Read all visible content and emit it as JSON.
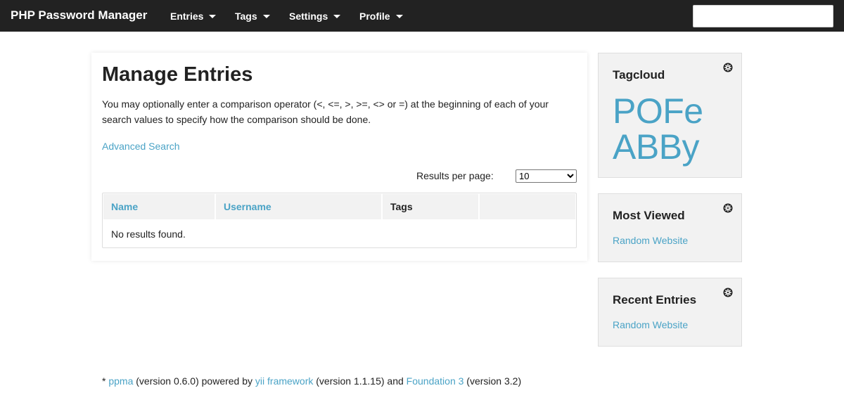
{
  "topbar": {
    "brand": "PHP Password Manager",
    "nav": [
      "Entries",
      "Tags",
      "Settings",
      "Profile"
    ],
    "search_value": ""
  },
  "main": {
    "title": "Manage Entries",
    "description": "You may optionally enter a comparison operator (<, <=, >, >=, <> or =) at the beginning of each of your search values to specify how the comparison should be done.",
    "advanced_search": "Advanced Search",
    "results_per_page_label": "Results per page:",
    "results_per_page_value": "10",
    "table": {
      "columns": [
        "Name",
        "Username",
        "Tags",
        ""
      ],
      "empty_text": "No results found."
    }
  },
  "sidebar": {
    "tagcloud": {
      "title": "Tagcloud",
      "tags": [
        "POFe",
        "ABBy"
      ]
    },
    "most_viewed": {
      "title": "Most Viewed",
      "items": [
        "Random Website"
      ]
    },
    "recent_entries": {
      "title": "Recent Entries",
      "items": [
        "Random Website"
      ]
    }
  },
  "footer": {
    "prefix": "* ",
    "ppma": "ppma",
    "ppma_version": " (version 0.6.0) powered by ",
    "yii": "yii framework",
    "yii_version": " (version 1.1.15) and ",
    "foundation": "Foundation 3",
    "foundation_version": " (version 3.2)"
  },
  "colors": {
    "topbar": "#222222",
    "link": "#4aa3c6",
    "panel": "#f2f2f2"
  },
  "icons": {
    "widget_gear": "gear-icon",
    "nav_caret": "caret-down-icon"
  }
}
